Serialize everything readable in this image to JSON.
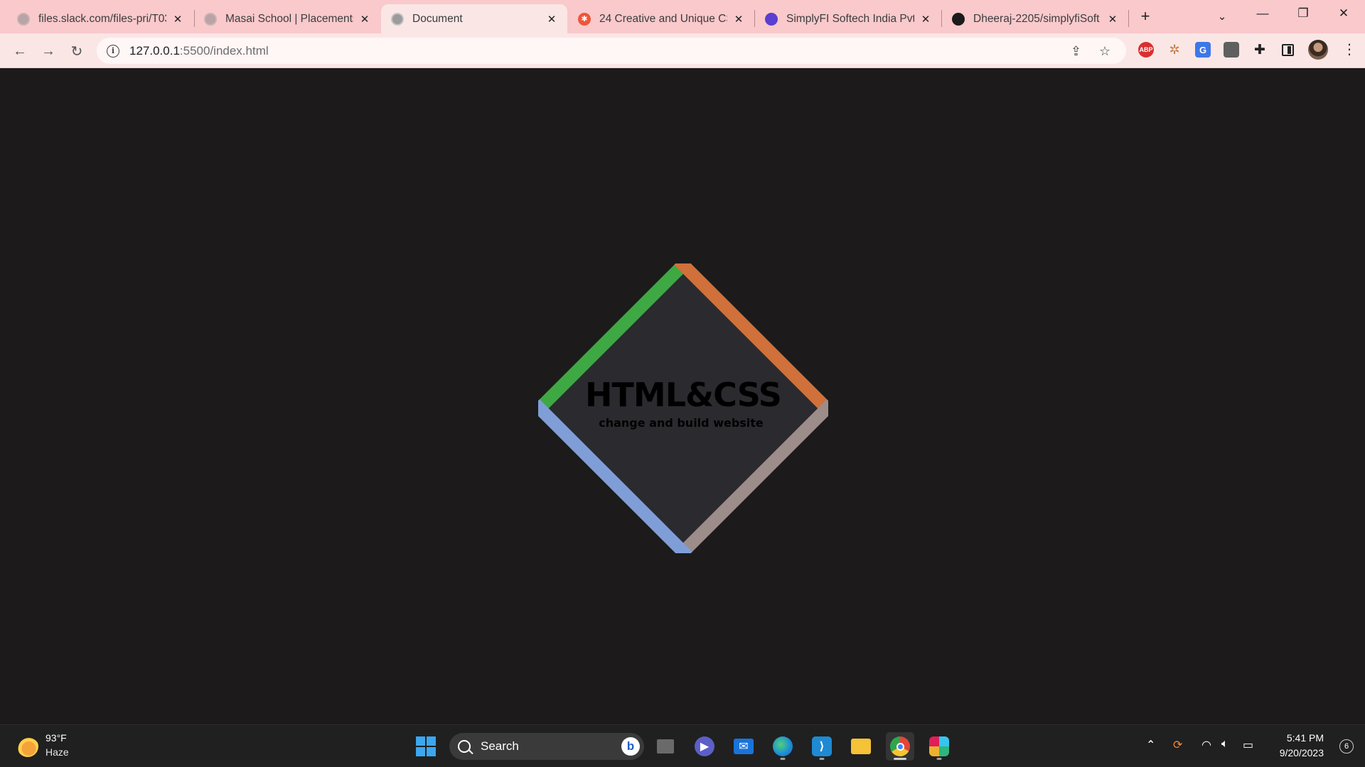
{
  "browser": {
    "tabs": [
      {
        "title": "files.slack.com/files-pri/T03",
        "icon": "globe-icon"
      },
      {
        "title": "Masai School | Placements",
        "icon": "globe-icon"
      },
      {
        "title": "Document",
        "icon": "globe-icon",
        "active": true
      },
      {
        "title": "24 Creative and Unique CS",
        "icon": "hubspot-icon"
      },
      {
        "title": "SimplyFI Softech India Pvt.",
        "icon": "list-icon"
      },
      {
        "title": "Dheeraj-2205/simplyfiSoft",
        "icon": "github-icon"
      }
    ],
    "new_tab_symbol": "+",
    "tab_close_symbol": "✕",
    "url_host": "127.0.0.1",
    "url_rest": ":5500/index.html",
    "extensions": [
      "adblock-plus-icon",
      "bug-extension-icon",
      "google-translate-icon",
      "window-extension-icon",
      "extensions-puzzle-icon",
      "side-panel-icon"
    ],
    "abp_label": "ABP",
    "g_label": "G"
  },
  "page": {
    "logo_title": "HTML&CSS",
    "logo_subtitle": "change and build website",
    "colors": {
      "background": "#1c1a1b",
      "diamond_fill": "#2b2a2f",
      "edge_top_left": "#3ea843",
      "edge_top_right": "#d0703a",
      "edge_bottom_right": "#9c8c8a",
      "edge_bottom_left": "#7f9ed8"
    }
  },
  "taskbar": {
    "weather_temp": "93°F",
    "weather_desc": "Haze",
    "search_label": "Search",
    "bing_label": "b",
    "apps": [
      "task-view-icon",
      "teams-meet-icon",
      "mail-icon",
      "edge-icon",
      "vscode-icon",
      "file-explorer-icon",
      "chrome-icon",
      "slack-icon"
    ],
    "time": "5:41 PM",
    "date": "9/20/2023",
    "notification_count": "6"
  }
}
